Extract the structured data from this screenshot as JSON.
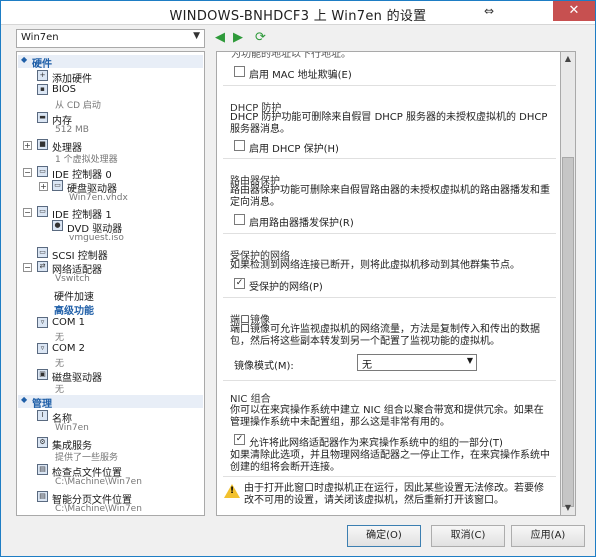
{
  "window": {
    "title": "WINDOWS-BNHDCF3 上 Win7en 的设置",
    "resize_glyph": "⇔",
    "close_glyph": "✕"
  },
  "vm_selector": {
    "value": "Win7en"
  },
  "tree": {
    "hardware_header": "硬件",
    "management_header": "管理",
    "items": {
      "add_hardware": "添加硬件",
      "bios": "BIOS",
      "bios_sub": "从 CD 启动",
      "memory": "内存",
      "memory_sub": "512 MB",
      "processor": "处理器",
      "processor_sub": "1 个虚拟处理器",
      "ide0": "IDE 控制器 0",
      "hdd": "硬盘驱动器",
      "hdd_sub": "Win7en.vhdx",
      "ide1": "IDE 控制器 1",
      "dvd": "DVD 驱动器",
      "dvd_sub": "vmguest.iso",
      "scsi": "SCSI 控制器",
      "nic": "网络适配器",
      "nic_sub": "Vswitch",
      "hw_accel": "硬件加速",
      "advanced": "高级功能",
      "com1": "COM 1",
      "com1_sub": "无",
      "com2": "COM 2",
      "com2_sub": "无",
      "floppy": "磁盘驱动器",
      "floppy_sub": "无",
      "name": "名称",
      "name_sub": "Win7en",
      "integration": "集成服务",
      "integration_sub": "提供了一些服务",
      "checkpoint": "检查点文件位置",
      "checkpoint_sub": "C:\\Machine\\Win7en",
      "paging": "智能分页文件位置",
      "paging_sub": "C:\\Machine\\Win7en"
    }
  },
  "content": {
    "top_cut_text": "为功能的地址以下行地址。",
    "mac_spoof_label": "启用 MAC 地址欺骗(E)",
    "mac_spoof_checked": false,
    "dhcp": {
      "title": "DHCP 防护",
      "desc": "DHCP 防护功能可删除来自假冒 DHCP 服务器的未授权虚拟机的 DHCP 服务器消息。",
      "check_label": "启用 DHCP 保护(H)",
      "checked": false
    },
    "router": {
      "title": "路由器保护",
      "desc": "路由器保护功能可删除来自假冒路由器的未授权虚拟机的路由器播发和重定向消息。",
      "check_label": "启用路由器播发保护(R)",
      "checked": false
    },
    "protected": {
      "title": "受保护的网络",
      "desc": "如果检测到网络连接已断开，则将此虚拟机移动到其他群集节点。",
      "check_label": "受保护的网络(P)",
      "checked": true
    },
    "mirror": {
      "title": "端口镜像",
      "desc": "端口镜像可允许监视虚拟机的网络流量，方法是复制传入和传出的数据包，然后将这些副本转发到另一个配置了监视功能的虚拟机。",
      "mode_label": "镜像模式(M):",
      "mode_value": "无"
    },
    "teaming": {
      "title": "NIC 组合",
      "desc": "你可以在来宾操作系统中建立 NIC 组合以聚合带宽和提供冗余。如果在管理操作系统中未配置组，那么这是非常有用的。",
      "check_label": "允许将此网络适配器作为来宾操作系统中的组的一部分(T)",
      "checked": true,
      "note": "如果清除此选项，并且物理网络适配器之一停止工作，在来宾操作系统中创建的组将会断开连接。"
    },
    "warning": "由于打开此窗口时虚拟机正在运行，因此某些设置无法修改。若要修改不可用的设置，请关闭该虚拟机，然后重新打开该窗口。"
  },
  "buttons": {
    "ok": "确定(O)",
    "cancel": "取消(C)",
    "apply": "应用(A)"
  }
}
